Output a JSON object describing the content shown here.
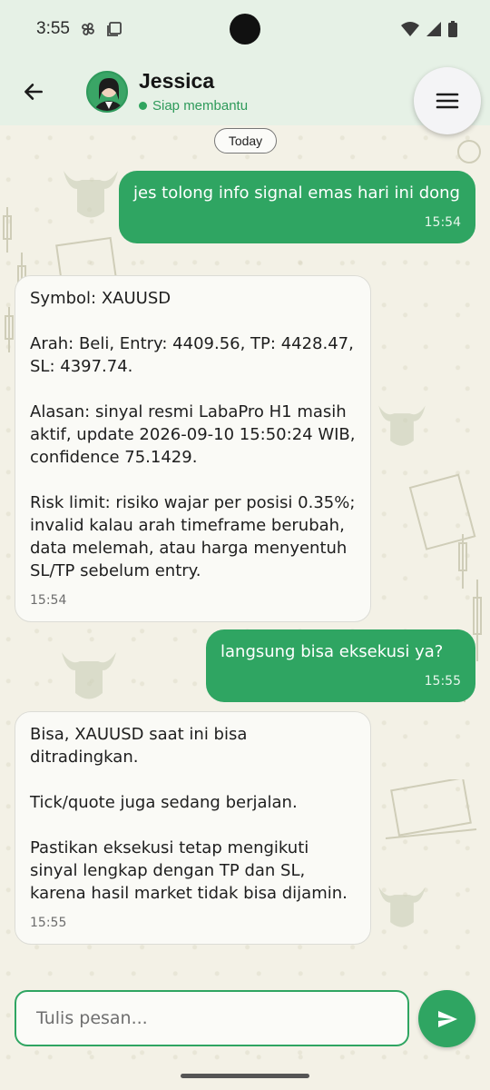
{
  "status_bar": {
    "time": "3:55"
  },
  "header": {
    "contact_name": "Jessica",
    "contact_status": "Siap membantu"
  },
  "date_chip": "Today",
  "messages": [
    {
      "direction": "out",
      "text": "jes tolong info signal emas hari ini dong",
      "time": "15:54"
    },
    {
      "direction": "in",
      "text": "Symbol: XAUUSD\n\nArah: Beli, Entry: 4409.56, TP: 4428.47, SL: 4397.74.\n\nAlasan: sinyal resmi LabaPro H1 masih aktif, update 2026-09-10 15:50:24 WIB, confidence 75.1429.\n\nRisk limit: risiko wajar per posisi 0.35%; invalid kalau arah timeframe berubah, data melemah, atau harga menyentuh SL/TP sebelum entry.",
      "time": "15:54"
    },
    {
      "direction": "out",
      "text": "langsung bisa eksekusi ya?",
      "time": "15:55"
    },
    {
      "direction": "in",
      "text": "Bisa, XAUUSD saat ini bisa ditradingkan.\n\nTick/quote juga sedang berjalan.\n\nPastikan eksekusi tetap mengikuti sinyal lengkap dengan TP dan SL, karena hasil market tidak bisa dijamin.",
      "time": "15:55"
    }
  ],
  "composer": {
    "placeholder": "Tulis pesan...",
    "value": ""
  },
  "colors": {
    "accent": "#2fa562",
    "header_bg": "#e6f1e6",
    "wallpaper_bg": "#f3f1e6"
  }
}
